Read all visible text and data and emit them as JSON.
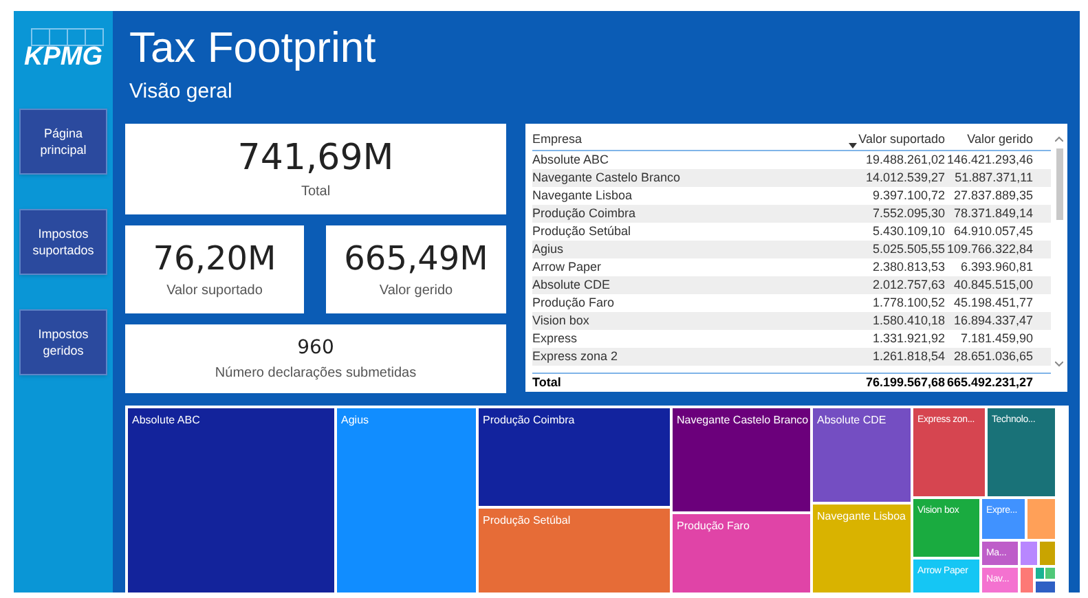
{
  "logo": "KPMG",
  "title": "Tax Footprint",
  "subtitle": "Visão geral",
  "nav": [
    {
      "label": "Página principal"
    },
    {
      "label": "Impostos suportados"
    },
    {
      "label": "Impostos geridos"
    }
  ],
  "kpis": [
    {
      "value": "741,69M",
      "label": "Total"
    },
    {
      "value": "76,20M",
      "label": "Valor suportado"
    },
    {
      "value": "665,49M",
      "label": "Valor gerido"
    },
    {
      "value": "960",
      "label": "Número declarações submetidas"
    }
  ],
  "table": {
    "columns": [
      {
        "label": "Empresa",
        "sorted": false
      },
      {
        "label": "Valor suportado",
        "sorted": true
      },
      {
        "label": "Valor gerido",
        "sorted": false
      }
    ],
    "rows": [
      [
        "Absolute ABC",
        "19.488.261,02",
        "146.421.293,46"
      ],
      [
        "Navegante Castelo Branco",
        "14.012.539,27",
        "51.887.371,11"
      ],
      [
        "Navegante Lisboa",
        "9.397.100,72",
        "27.837.889,35"
      ],
      [
        "Produção Coimbra",
        "7.552.095,30",
        "78.371.849,14"
      ],
      [
        "Produção Setúbal",
        "5.430.109,10",
        "64.910.057,45"
      ],
      [
        "Agius",
        "5.025.505,55",
        "109.766.322,84"
      ],
      [
        "Arrow Paper",
        "2.380.813,53",
        "6.393.960,81"
      ],
      [
        "Absolute CDE",
        "2.012.757,63",
        "40.845.515,00"
      ],
      [
        "Produção Faro",
        "1.778.100,52",
        "45.198.451,77"
      ],
      [
        "Vision box",
        "1.580.410,18",
        "16.894.337,47"
      ],
      [
        "Express",
        "1.331.921,92",
        "7.181.459,90"
      ],
      [
        "Express zona 2",
        "1.261.818,54",
        "28.651.036,65"
      ]
    ],
    "total": [
      "Total",
      "76.199.567,68",
      "665.492.231,27"
    ]
  },
  "treemap": [
    {
      "label": "Absolute ABC",
      "color": "#13239b"
    },
    {
      "label": "Agius",
      "color": "#118dff"
    },
    {
      "label": "Produção Coimbra",
      "color": "#12239e"
    },
    {
      "label": "Produção Setúbal",
      "color": "#e66c37"
    },
    {
      "label": "Navegante Castelo Branco",
      "color": "#6b007b"
    },
    {
      "label": "Produção Faro",
      "color": "#e044a7"
    },
    {
      "label": "Absolute CDE",
      "color": "#744ec2"
    },
    {
      "label": "Navegante Lisboa",
      "color": "#d9b300"
    },
    {
      "label": "Express zon...",
      "color": "#d64550"
    },
    {
      "label": "Technolo...",
      "color": "#197278"
    },
    {
      "label": "Vision box",
      "color": "#1aab40"
    },
    {
      "label": "Arrow Paper",
      "color": "#15c6f4"
    },
    {
      "label": "Expre...",
      "color": "#4092ff"
    },
    {
      "color": "#ffa058"
    },
    {
      "label": "Ma...",
      "color": "#be5dc9"
    },
    {
      "color": "#b887ff"
    },
    {
      "color": "#c9a400"
    },
    {
      "label": "Nav...",
      "color": "#f472d0"
    },
    {
      "color": "#fd7976"
    },
    {
      "color": "#1ab394"
    },
    {
      "color": "#50c878"
    },
    {
      "color": "#2e5fc4"
    }
  ]
}
